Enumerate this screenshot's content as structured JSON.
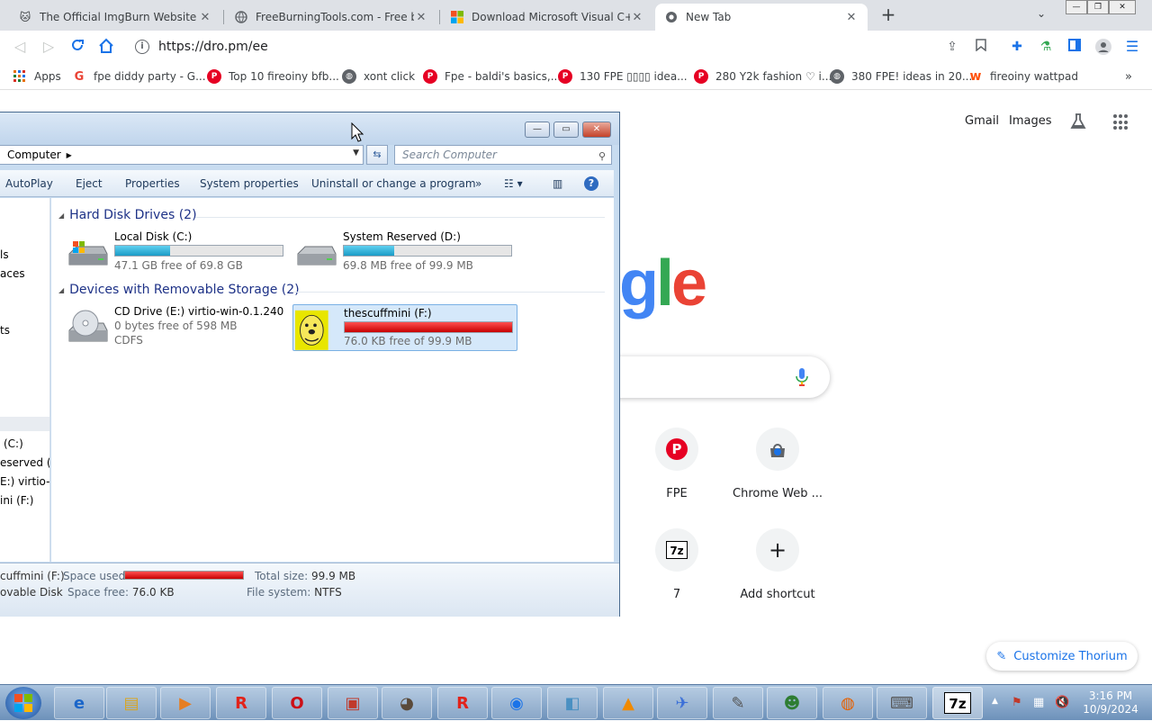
{
  "browser": {
    "tabs": [
      {
        "title": "The Official ImgBurn Website",
        "active": false
      },
      {
        "title": "FreeBurningTools.com - Free bur",
        "active": false
      },
      {
        "title": "Download Microsoft Visual C++",
        "active": false
      },
      {
        "title": "New Tab",
        "active": true
      }
    ],
    "url": "https://dro.pm/ee",
    "bookmarks": [
      {
        "label": "Apps",
        "icon": "apps-grid-icon"
      },
      {
        "label": "fpe diddy party - G...",
        "icon": "google-icon"
      },
      {
        "label": "Top 10 fireoiny bfb...",
        "icon": "pinterest-icon"
      },
      {
        "label": "xont click",
        "icon": "globe-icon"
      },
      {
        "label": "Fpe - baldi's basics,...",
        "icon": "pinterest-icon"
      },
      {
        "label": "130 FPE ▯▯▯▯ idea...",
        "icon": "pinterest-icon"
      },
      {
        "label": "280 Y2k fashion ♡ i...",
        "icon": "pinterest-icon"
      },
      {
        "label": "380 FPE! ideas in 20...",
        "icon": "globe-icon"
      },
      {
        "label": "fireoiny wattpad",
        "icon": "wattpad-icon"
      }
    ]
  },
  "ntp": {
    "gmail": "Gmail",
    "images": "Images",
    "logo_visible": "gle",
    "shortcuts": [
      {
        "label": "FPE",
        "icon": "pinterest-icon"
      },
      {
        "label": "Chrome Web ...",
        "icon": "chrome-web-store-icon"
      },
      {
        "label": "7",
        "icon": "7zip-icon"
      },
      {
        "label": "Add shortcut",
        "icon": "plus-icon"
      }
    ],
    "customize": "Customize Thorium"
  },
  "explorer": {
    "address": "Computer",
    "search_placeholder": "Search Computer",
    "commands": [
      "AutoPlay",
      "Eject",
      "Properties",
      "System properties",
      "Uninstall or change a program"
    ],
    "nav_partial": [
      "ls",
      "aces",
      "ts",
      "(C:)",
      "eserved (D:",
      "E:) virtio-v",
      "ini (F:)"
    ],
    "groups": [
      {
        "title": "Hard Disk Drives (2)",
        "drives": [
          {
            "name": "Local Disk (C:)",
            "free": "47.1 GB free of 69.8 GB",
            "used_fraction": 0.33
          },
          {
            "name": "System Reserved (D:)",
            "free": "69.8 MB free of 99.9 MB",
            "used_fraction": 0.3
          }
        ]
      },
      {
        "title": "Devices with Removable Storage (2)",
        "drives": [
          {
            "name": "CD Drive (E:) virtio-win-0.1.240",
            "free": "0 bytes free of 598 MB",
            "fs": "CDFS"
          },
          {
            "name": "thescuffmini (F:)",
            "free": "76.0 KB free of 99.9 MB",
            "used_fraction": 0.999
          }
        ]
      }
    ],
    "details": {
      "name": "cuffmini (F:)",
      "type": "ovable Disk",
      "space_used_label": "Space used:",
      "space_free_label": "Space free:",
      "space_free": "76.0 KB",
      "total_size_label": "Total size:",
      "total_size": "99.9 MB",
      "fs_label": "File system:",
      "fs": "NTFS"
    }
  },
  "taskbar": {
    "time": "3:16 PM",
    "date": "10/9/2024"
  }
}
